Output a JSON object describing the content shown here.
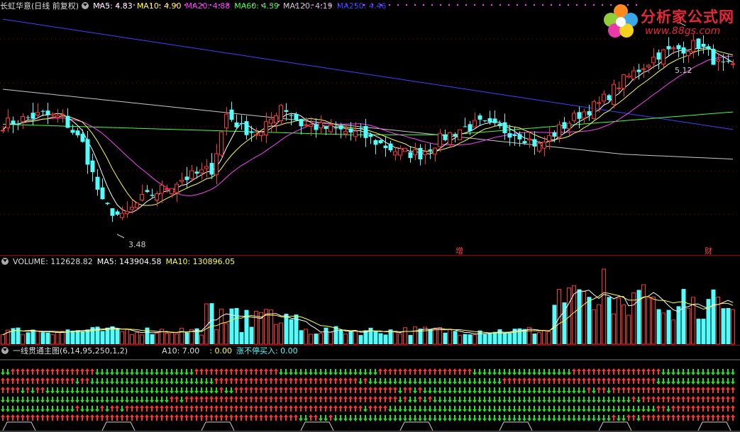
{
  "price_header": {
    "title": "长虹华意(日线 前复权)",
    "ma5": "MA5: 4.83",
    "ma10": "MA10: 4.90",
    "ma20": "MA20: 4.88",
    "ma60": "MA60: 4.39",
    "ma120": "MA120: 4.19",
    "ma250": "MA250: 4.46"
  },
  "volume_header": {
    "volume": "VOLUME: 112628.82",
    "ma5": "MA5: 143904.58",
    "ma10": "MA10: 130896.05"
  },
  "indicator_header": {
    "name": "一线贯通主图(6,14,95,250,1,2)",
    "a10": "A10: 7.00",
    "x": ": 0.00",
    "zt": "涨不停买入: 0.00"
  },
  "annotations": {
    "high": "5.12",
    "low": "3.48",
    "tag_zeng": "增",
    "tag_cai": "财"
  },
  "logo": {
    "title": "分析家公式网",
    "url": "www.88gs.com"
  },
  "colors": {
    "ma5": "#ffffff",
    "ma10": "#ffff40",
    "ma20": "#ff40ff",
    "ma60": "#40ff40",
    "ma120": "#c8c8c8",
    "ma250": "#4040ff",
    "up": "#ff3232",
    "down": "#54fcfc",
    "bg": "#000000",
    "divider": "#a00000"
  }
}
